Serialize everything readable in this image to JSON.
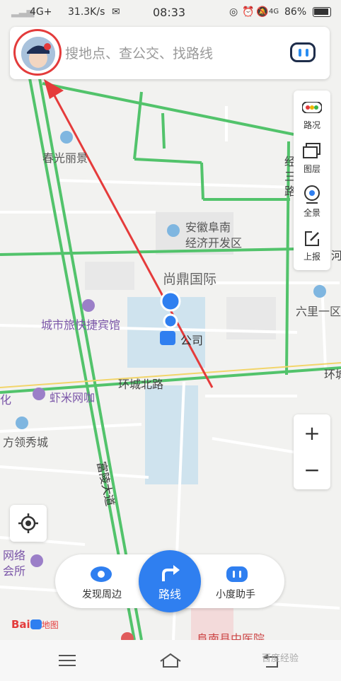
{
  "status_bar": {
    "network": "4G+",
    "speed": "31.3K/s",
    "time": "08:33",
    "network2": "4G",
    "battery": "86%"
  },
  "search": {
    "placeholder": "搜地点、查公交、找路线"
  },
  "right_panel": [
    {
      "label": "路况",
      "icon": "traffic-icon"
    },
    {
      "label": "图层",
      "icon": "layers-icon"
    },
    {
      "label": "全景",
      "icon": "panorama-icon"
    },
    {
      "label": "上报",
      "icon": "report-icon"
    }
  ],
  "zoom": {
    "in": "+",
    "out": "−"
  },
  "map_labels": {
    "chunguang": "春光丽景",
    "anhui": "安徽阜南",
    "kaifaqu": "经济开发区",
    "shangding": "尚鼎国际",
    "hotel": "城市旅快捷宾馆",
    "company": "公司",
    "liuli": "六里一区",
    "huancheng": "环城北路",
    "huancheng_right": "环城",
    "xiami": "虾米网咖",
    "hua": "化",
    "fangling": "方领秀城",
    "fuling": "富陵大道",
    "wangluo1": "网络",
    "wangluo2": "会所",
    "hospital": "阜南县中医院",
    "jing": "经",
    "san": "三",
    "lu": "路",
    "he": "河"
  },
  "bottom_bar": {
    "discover": "发现周边",
    "route": "路线",
    "assistant": "小度助手"
  },
  "logo": {
    "text": "Bai",
    "text2": "地图"
  },
  "watermark": "百度经验"
}
